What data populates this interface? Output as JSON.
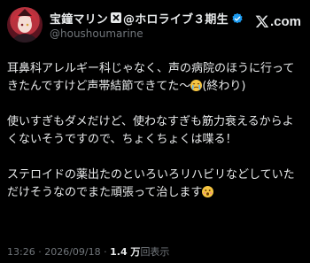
{
  "author": {
    "display_name": "宝鐘マリン",
    "affiliation": "@ホロライブ３期生",
    "handle": "@houshoumarine",
    "avatar_icon": "avatar-icon",
    "verified_icon": "verified-badge-icon",
    "org_icon": "org-badge-icon"
  },
  "brand": {
    "logo_text": ".com",
    "logo_icon": "x-logo-icon"
  },
  "tweet": {
    "p1_text": "耳鼻科アレルギー科じゃなく、声の病院のほうに行ってきたんですけど声帯結節できてた〜",
    "p1_tail": "(終わり)",
    "p1_emoji": "crying-face-emoji",
    "p2_text": "使いすぎもダメだけど、使わなすぎも筋力衰えるからよくないそうですので、ちょくちょくは喋る！",
    "p3_text": "ステロイドの薬出たのといろいろリハビリなどしていただけそうなのでまた頑張って治します",
    "p3_emoji": "astonished-face-emoji"
  },
  "meta": {
    "time": "13:26",
    "separator1": " · ",
    "date": "2026/09/18",
    "separator2": " · ",
    "views_count": "1.4 万",
    "views_label": "回表示"
  },
  "colors": {
    "background": "#000000",
    "text": "#e7e9ea",
    "muted": "#71767b",
    "verified": "#1d9bf0"
  }
}
